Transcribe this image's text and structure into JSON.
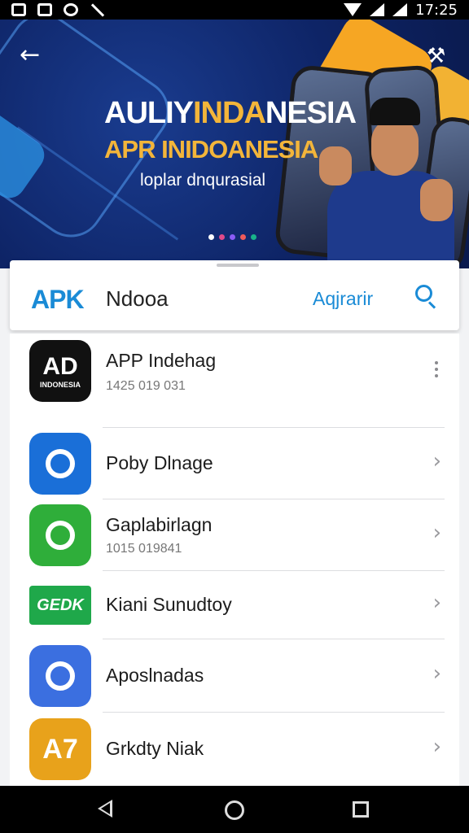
{
  "status_bar": {
    "time": "17:25"
  },
  "banner": {
    "title_part1": "AULIY",
    "title_part2": "INDA",
    "title_part3": "NESIA",
    "subtitle": "APR INIDOANESIA",
    "tagline": "loplar dnqurasial",
    "carousel_dot_colors": [
      "#ffffff",
      "#e04a8a",
      "#8b5cf6",
      "#f05a5a",
      "#19b38a"
    ]
  },
  "search_bar": {
    "logo": "APK",
    "app_name": "Ndooa",
    "action_label": "Aqjrarir"
  },
  "apps": [
    {
      "title": "APP Indehag",
      "subtitle": "1425 019 031",
      "icon_text": "AD",
      "icon_sub": "INDONESIA",
      "icon_bg": "#111111",
      "trailing": "more"
    },
    {
      "title": "Poby Dlnage",
      "subtitle": "",
      "icon_text": "",
      "icon_bg": "#1a6fd8",
      "trailing": "chevron"
    },
    {
      "title": "Gaplabirlagn",
      "subtitle": "1015 019841",
      "icon_text": "",
      "icon_bg": "#2fae3a",
      "trailing": "chevron"
    },
    {
      "title": "Kiani Sunudtoy",
      "subtitle": "",
      "icon_text": "GEDK",
      "icon_bg": "#1fa84a",
      "trailing": "chevron"
    },
    {
      "title": "Aposlnadas",
      "subtitle": "",
      "icon_text": "",
      "icon_bg": "#3b6fe0",
      "trailing": "chevron"
    },
    {
      "title": "Grkdty Niak",
      "subtitle": "",
      "icon_text": "A7",
      "icon_bg": "#e8a21b",
      "trailing": "chevron"
    }
  ],
  "icons": {
    "back": "←",
    "tools": "⚒",
    "chevron": "›"
  }
}
